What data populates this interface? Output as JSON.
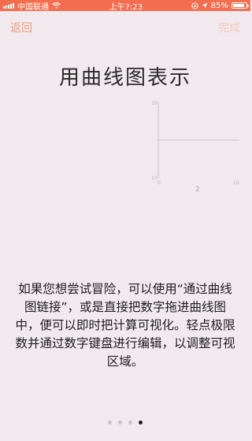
{
  "status_bar": {
    "carrier": "中国联通",
    "time": "上午7:23",
    "battery_percent": "85%",
    "battery_level": 0.85,
    "icons": [
      "signal-icon",
      "wifi-icon",
      "rotation-lock-icon",
      "location-icon",
      "battery-icon"
    ]
  },
  "nav": {
    "back_label": "返回",
    "done_label": "完成"
  },
  "title": "用曲线图表示",
  "graph": {
    "y_top_label": "10",
    "y_bottom_label": "10",
    "x_left_label": "0",
    "x_right_label": "10",
    "center_label": "2"
  },
  "description": "如果您想尝试冒险，可以使用“通过曲线图链接”，或是直接把数字拖进曲线图中，便可以即时把计算可视化。轻点极限数并通过数字键盘进行编辑，以调整可视区域。",
  "pagination": {
    "total": 4,
    "active_index": 3
  },
  "colors": {
    "status_bar": "#f36d4e",
    "accent": "#f39a78",
    "background": "#f1e9ee"
  }
}
